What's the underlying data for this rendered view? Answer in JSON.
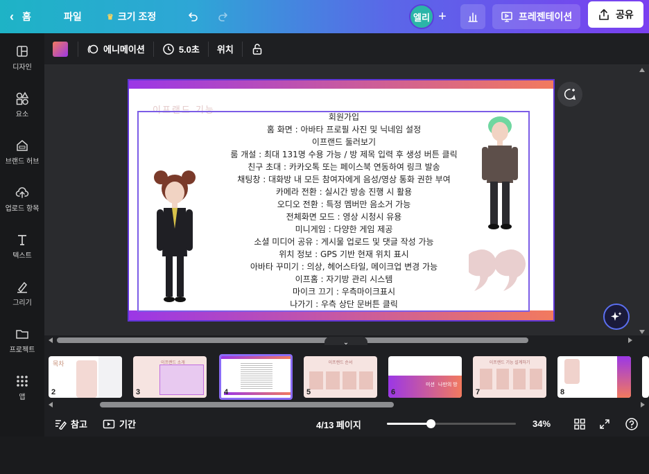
{
  "topbar": {
    "back_label": "홈",
    "file_label": "파일",
    "resize_label": "크기 조정",
    "avatar_label": "엘리",
    "present_label": "프레젠테이션",
    "share_label": "공유"
  },
  "toolbar": {
    "animation_label": "에니메이션",
    "duration_label": "5.0초",
    "position_label": "위치"
  },
  "sidebar": {
    "items": [
      {
        "label": "디자인"
      },
      {
        "label": "요소"
      },
      {
        "label": "브랜드 허브"
      },
      {
        "label": "업로드 항목"
      },
      {
        "label": "텍스트"
      },
      {
        "label": "그리기"
      },
      {
        "label": "프로젝트"
      },
      {
        "label": "앱"
      }
    ]
  },
  "slide": {
    "faded_title": "이프랜드 기능",
    "lines": [
      "회원가입",
      "홈 화면 : 아바타 프로필 사진 및 닉네임 설정",
      "이프랜드 둘러보기",
      "룸 개설 : 최대 131명 수용 가능 / 방 제목 입력 후 생성 버튼 클릭",
      "친구 초대 : 카카오톡 또는 페이스북 연동하여 링크 발송",
      "채팅창 : 대화방 내 모든 참여자에게 음성/영상 통화 권한 부여",
      "카메라 전환 : 실시간 방송 진행 시 활용",
      "오디오 전환 : 특정 멤버만 음소거 가능",
      "전체화면 모드 : 영상 시청시 유용",
      "미니게임 : 다양한 게임 제공",
      "소셜 미디어 공유 : 게시물 업로드 및 댓글 작성 가능",
      "위치 정보 : GPS 기반 현재 위치 표시",
      "아바타 꾸미기 : 의상, 헤어스타일, 메이크업 변경 가능",
      "이프홈 : 자기방 관리 시스템",
      "마이크 끄기 : 우측마이크표시",
      "나가기 : 우측 상단 문버튼 클릭"
    ]
  },
  "filmstrip": {
    "thumbs": [
      {
        "num": "2",
        "title": "목차"
      },
      {
        "num": "3",
        "title": "이프랜드 소개"
      },
      {
        "num": "4",
        "title": ""
      },
      {
        "num": "5",
        "title": "이프랜드 순서"
      },
      {
        "num": "6",
        "title": "미션 나만의 방"
      },
      {
        "num": "7",
        "title": "이프랜드 기능 설계하기"
      },
      {
        "num": "8",
        "title": ""
      }
    ],
    "thumb6_label_a": "미션",
    "thumb6_label_b": "나만의 방"
  },
  "bottombar": {
    "notes_label": "참고",
    "duration_label": "기간",
    "page_indicator": "4/13 페이지",
    "zoom_label": "34%",
    "zoom_level": 0.34
  },
  "colors": {
    "accent": "#7d2ae8",
    "slide_border": "#5e35d6",
    "avatar_bg": "#2bb5a8"
  }
}
